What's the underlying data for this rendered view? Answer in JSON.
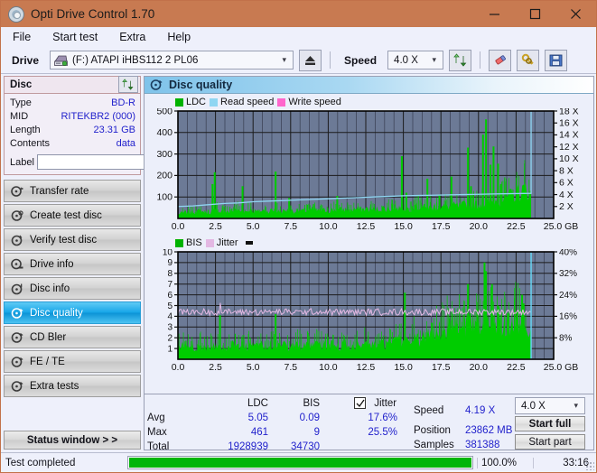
{
  "window": {
    "title": "Opti Drive Control 1.70",
    "icon": "disc-icon",
    "minimize": "minimize-icon",
    "maximize": "maximize-icon",
    "close": "close-icon",
    "titlebar_color": "#c87a51"
  },
  "menu": {
    "items": [
      "File",
      "Start test",
      "Extra",
      "Help"
    ]
  },
  "toolbar": {
    "drive_label": "Drive",
    "drive_value": "(F:)  ATAPI iHBS112  2 PL06",
    "eject_icon": "eject-icon",
    "speed_label": "Speed",
    "speed_value": "4.0 X",
    "refresh_icon": "refresh-icon",
    "erase_icon": "eraser-icon",
    "keys_icon": "keys-icon",
    "save_icon": "save-icon"
  },
  "disc_panel": {
    "heading": "Disc",
    "refresh_icon": "refresh-icon",
    "rows": [
      {
        "key": "Type",
        "value": "BD-R"
      },
      {
        "key": "MID",
        "value": "RITEKBR2 (000)"
      },
      {
        "key": "Length",
        "value": "23.31 GB"
      },
      {
        "key": "Contents",
        "value": "data"
      }
    ],
    "label_key": "Label",
    "label_value": "",
    "label_placeholder": "",
    "label_button_icon": "disc-icon"
  },
  "nav": {
    "items": [
      {
        "label": "Transfer rate",
        "icon": "disc-speed-icon",
        "selected": false
      },
      {
        "label": "Create test disc",
        "icon": "disc-write-icon",
        "selected": false
      },
      {
        "label": "Verify test disc",
        "icon": "disc-verify-icon",
        "selected": false
      },
      {
        "label": "Drive info",
        "icon": "disc-drive-icon",
        "selected": false
      },
      {
        "label": "Disc info",
        "icon": "disc-info-icon",
        "selected": false
      },
      {
        "label": "Disc quality",
        "icon": "disc-quality-icon",
        "selected": true
      },
      {
        "label": "CD Bler",
        "icon": "disc-bler-icon",
        "selected": false
      },
      {
        "label": "FE / TE",
        "icon": "disc-fete-icon",
        "selected": false
      },
      {
        "label": "Extra tests",
        "icon": "disc-extra-icon",
        "selected": false
      }
    ],
    "status_window": "Status window > >"
  },
  "content": {
    "heading": "Disc quality",
    "heading_icon": "disc-quality-icon"
  },
  "stats": {
    "col_ldc": "LDC",
    "col_bis": "BIS",
    "jitter_label": "Jitter",
    "jitter_checked": true,
    "row_avg": "Avg",
    "row_max": "Max",
    "row_total": "Total",
    "avg_ldc": "5.05",
    "avg_bis": "0.09",
    "avg_jitter": "17.6%",
    "max_ldc": "461",
    "max_bis": "9",
    "max_jitter": "25.5%",
    "total_ldc": "1928939",
    "total_bis": "34730",
    "speed_label": "Speed",
    "speed_value": "4.19 X",
    "position_label": "Position",
    "position_value": "23862 MB",
    "samples_label": "Samples",
    "samples_value": "381388",
    "speed_select": "4.0 X",
    "start_full": "Start full",
    "start_part": "Start part"
  },
  "statusbar": {
    "text": "Test completed",
    "percent": "100.0%",
    "progress": 100,
    "time": "33:16",
    "bar_color": "#00b50a"
  },
  "chart_data": [
    {
      "type": "area",
      "id": "ldc-chart",
      "title": "LDC / Read speed / Write speed",
      "xlabel": "GB",
      "ylabel": "LDC",
      "xlim": [
        0,
        25
      ],
      "ylim": [
        0,
        500
      ],
      "xticks": [
        "0.0",
        "2.5",
        "5.0",
        "7.5",
        "10.0",
        "12.5",
        "15.0",
        "17.5",
        "20.0",
        "22.5",
        "25.0 GB"
      ],
      "yticks": [
        100,
        200,
        300,
        400,
        500
      ],
      "y2label": "Speed (X)",
      "y2lim": [
        0,
        18
      ],
      "y2ticks": [
        "2 X",
        "4 X",
        "6 X",
        "8 X",
        "10 X",
        "12 X",
        "14 X",
        "16 X",
        "18 X"
      ],
      "grid": true,
      "legend_position": "top-left",
      "plot_bgcolor": "#6c7a96",
      "legend": [
        {
          "name": "LDC",
          "color": "#00b200"
        },
        {
          "name": "Read speed",
          "color": "#8fd6f2"
        },
        {
          "name": "Write speed",
          "color": "#ff66cc"
        }
      ],
      "series": [
        {
          "name": "LDC",
          "color": "#00cc00",
          "note": "baseline error density with sharp spikes; ends at 23.5 GB",
          "baseline": [
            18,
            22,
            26,
            24,
            28,
            30,
            26,
            25,
            30,
            32,
            28,
            26,
            30,
            34,
            30,
            28,
            32,
            30,
            28,
            32,
            30,
            34,
            30,
            28,
            32,
            34,
            30,
            32,
            30,
            34,
            36,
            32,
            30,
            34,
            32,
            36,
            34,
            38,
            36,
            34,
            38,
            36,
            40,
            38,
            36,
            40,
            42,
            38,
            40,
            42,
            44,
            42,
            40,
            44,
            46,
            44,
            42,
            46,
            48,
            46,
            50,
            48,
            52,
            50,
            54,
            52,
            56,
            58,
            60,
            62,
            66,
            70,
            76,
            82,
            88,
            96,
            104,
            112,
            118,
            96
          ],
          "spikes": [
            {
              "x": 2.3,
              "y": 160
            },
            {
              "x": 2.45,
              "y": 215
            },
            {
              "x": 4.3,
              "y": 150
            },
            {
              "x": 6.5,
              "y": 218
            },
            {
              "x": 7.4,
              "y": 95
            },
            {
              "x": 10.6,
              "y": 105
            },
            {
              "x": 14.9,
              "y": 290
            },
            {
              "x": 15.2,
              "y": 120
            },
            {
              "x": 16.6,
              "y": 185
            },
            {
              "x": 17.4,
              "y": 110
            },
            {
              "x": 18.2,
              "y": 195
            },
            {
              "x": 19.3,
              "y": 330
            },
            {
              "x": 19.5,
              "y": 150
            },
            {
              "x": 20.3,
              "y": 390
            },
            {
              "x": 20.5,
              "y": 461
            },
            {
              "x": 20.8,
              "y": 250
            },
            {
              "x": 21.0,
              "y": 335
            },
            {
              "x": 21.3,
              "y": 255
            },
            {
              "x": 21.5,
              "y": 160
            },
            {
              "x": 22.2,
              "y": 120
            }
          ]
        },
        {
          "name": "Read speed",
          "color": "#8fd6f2",
          "note": "CAV ramp from ~2.0X at 0 GB up to ~4.2X at 23.5 GB, then vertical to top",
          "points": [
            [
              0.0,
              2.0
            ],
            [
              1.0,
              2.1
            ],
            [
              2.0,
              2.3
            ],
            [
              3.0,
              2.5
            ],
            [
              4.0,
              2.6
            ],
            [
              5.0,
              2.8
            ],
            [
              6.0,
              2.9
            ],
            [
              7.0,
              3.0
            ],
            [
              8.0,
              3.1
            ],
            [
              9.0,
              3.2
            ],
            [
              10.0,
              3.3
            ],
            [
              11.0,
              3.4
            ],
            [
              12.0,
              3.5
            ],
            [
              13.0,
              3.6
            ],
            [
              14.0,
              3.7
            ],
            [
              15.0,
              3.8
            ],
            [
              16.0,
              3.85
            ],
            [
              17.0,
              3.9
            ],
            [
              18.0,
              3.95
            ],
            [
              19.0,
              4.0
            ],
            [
              20.0,
              4.05
            ],
            [
              21.0,
              4.1
            ],
            [
              22.0,
              4.15
            ],
            [
              23.0,
              4.19
            ],
            [
              23.5,
              4.2
            ],
            [
              23.5,
              18.0
            ]
          ]
        },
        {
          "name": "Write speed",
          "color": "#ff66cc",
          "points": []
        }
      ]
    },
    {
      "type": "area",
      "id": "bis-chart",
      "title": "BIS / Jitter",
      "xlabel": "GB",
      "ylabel": "BIS",
      "xlim": [
        0,
        25
      ],
      "ylim": [
        0,
        10
      ],
      "xticks": [
        "0.0",
        "2.5",
        "5.0",
        "7.5",
        "10.0",
        "12.5",
        "15.0",
        "17.5",
        "20.0",
        "22.5",
        "25.0 GB"
      ],
      "yticks": [
        1,
        2,
        3,
        4,
        5,
        6,
        7,
        8,
        9,
        10
      ],
      "y2label": "Jitter (%)",
      "y2lim": [
        0,
        40
      ],
      "y2ticks": [
        "8%",
        "16%",
        "24%",
        "32%",
        "40%"
      ],
      "grid": true,
      "legend_position": "top-left",
      "plot_bgcolor": "#6c7a96",
      "legend": [
        {
          "name": "BIS",
          "color": "#00b200"
        },
        {
          "name": "Jitter",
          "color": "#e3b8e3"
        }
      ],
      "series": [
        {
          "name": "BIS",
          "color": "#00cc00",
          "note": "dense 1-2 band across disc, rising to 2-3 after 19 GB; ends 23.5 GB",
          "baseline": [
            1.0,
            1.1,
            1.0,
            1.2,
            1.0,
            1.1,
            1.0,
            1.0,
            1.2,
            1.0,
            1.1,
            1.0,
            1.2,
            1.0,
            1.1,
            1.0,
            1.1,
            1.0,
            1.2,
            1.1,
            1.0,
            1.1,
            1.0,
            1.2,
            1.1,
            1.0,
            1.1,
            1.2,
            1.0,
            1.1,
            1.0,
            1.2,
            1.1,
            1.0,
            1.2,
            1.1,
            1.0,
            1.2,
            1.1,
            1.0,
            1.2,
            1.1,
            1.3,
            1.1,
            1.2,
            1.3,
            1.2,
            1.4,
            1.3,
            1.5,
            1.4,
            1.6,
            1.5,
            1.7,
            1.6,
            1.8,
            1.9,
            2.0,
            2.2,
            2.4,
            2.6,
            2.8,
            3.0,
            2.9,
            2.8,
            2.9,
            3.0,
            2.8,
            2.7,
            2.9,
            3.0,
            2.8,
            2.9,
            3.0,
            2.8,
            2.9,
            3.0,
            2.8,
            2.9,
            2.6
          ],
          "spikes": [
            {
              "x": 2.8,
              "y": 4.1
            },
            {
              "x": 6.5,
              "y": 4.2
            },
            {
              "x": 15.1,
              "y": 6.2
            },
            {
              "x": 16.9,
              "y": 3.4
            },
            {
              "x": 19.3,
              "y": 7.0
            },
            {
              "x": 20.4,
              "y": 9.0
            },
            {
              "x": 20.5,
              "y": 8.2
            },
            {
              "x": 20.9,
              "y": 7.0
            },
            {
              "x": 21.3,
              "y": 5.0
            },
            {
              "x": 22.9,
              "y": 6.0
            },
            {
              "x": 23.0,
              "y": 5.2
            }
          ]
        },
        {
          "name": "Jitter",
          "color": "#e3b8e3",
          "note": "near-flat noisy trace around 4.3-4.7 on BIS scale (~17-19%), spikes at 2.8 and 17.5",
          "mean": 4.4,
          "noise": 0.18,
          "spikes": [
            {
              "x": 2.8,
              "y": 6.3
            },
            {
              "x": 17.5,
              "y": 6.1
            },
            {
              "x": 20.4,
              "y": 6.4
            }
          ]
        }
      ],
      "cursor": {
        "x": 23.5,
        "color": "#66d9f7"
      }
    }
  ]
}
